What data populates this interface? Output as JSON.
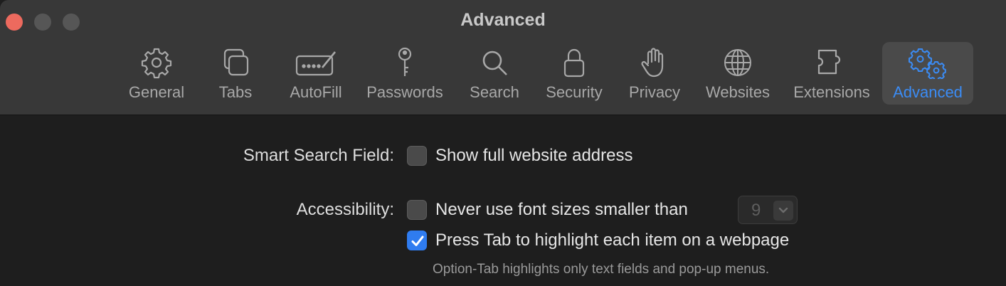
{
  "window": {
    "title": "Advanced"
  },
  "toolbar": {
    "items": [
      {
        "label": "General",
        "icon": "gear-icon"
      },
      {
        "label": "Tabs",
        "icon": "tabs-icon"
      },
      {
        "label": "AutoFill",
        "icon": "keyboard-pen-icon"
      },
      {
        "label": "Passwords",
        "icon": "key-icon"
      },
      {
        "label": "Search",
        "icon": "magnifier-icon"
      },
      {
        "label": "Security",
        "icon": "lock-icon"
      },
      {
        "label": "Privacy",
        "icon": "hand-icon"
      },
      {
        "label": "Websites",
        "icon": "globe-icon"
      },
      {
        "label": "Extensions",
        "icon": "puzzle-icon"
      },
      {
        "label": "Advanced",
        "icon": "gears-icon",
        "selected": true
      }
    ]
  },
  "settings": {
    "smart_search": {
      "label": "Smart Search Field:",
      "option": "Show full website address",
      "checked": false
    },
    "accessibility": {
      "label": "Accessibility:",
      "min_font": {
        "option": "Never use font sizes smaller than",
        "checked": false,
        "value": "9",
        "enabled": false
      },
      "tab_highlight": {
        "option": "Press Tab to highlight each item on a webpage",
        "checked": true,
        "hint": "Option-Tab highlights only text fields and pop-up menus."
      }
    }
  },
  "colors": {
    "accent": "#3b8cf5",
    "close": "#ed6a5e",
    "titlebar": "#383838",
    "content_bg": "#1e1e1e"
  }
}
